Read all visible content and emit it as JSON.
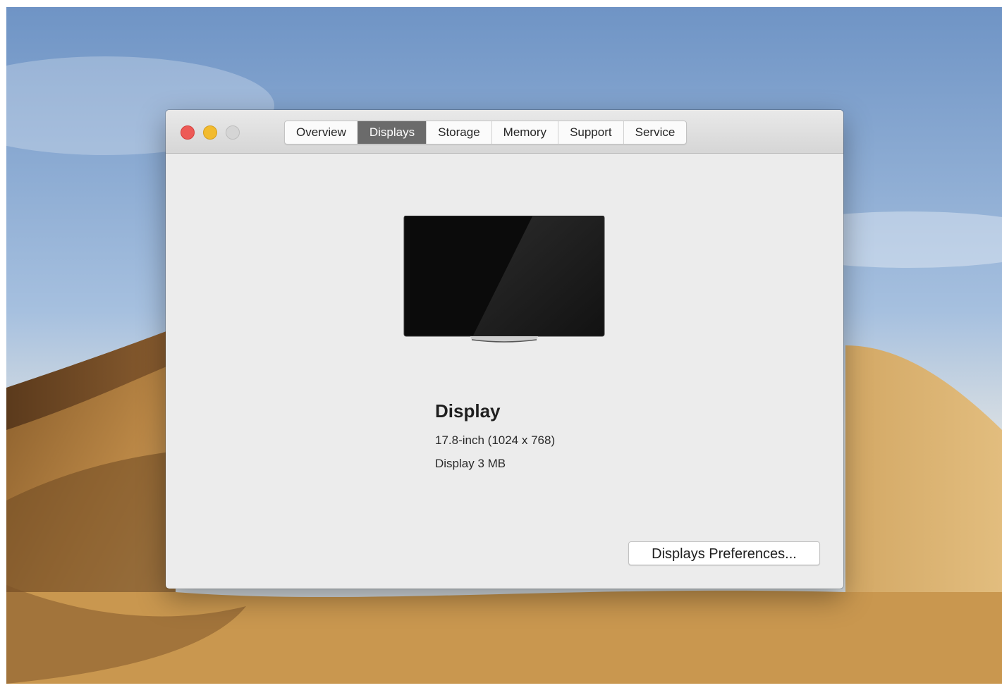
{
  "window": {
    "tabs": [
      {
        "label": "Overview"
      },
      {
        "label": "Displays"
      },
      {
        "label": "Storage"
      },
      {
        "label": "Memory"
      },
      {
        "label": "Support"
      },
      {
        "label": "Service"
      }
    ],
    "active_tab": "Displays"
  },
  "display": {
    "title": "Display",
    "size_resolution": "17.8-inch (1024 x 768)",
    "memory": "Display 3 MB",
    "preferences_button": "Displays Preferences..."
  },
  "icons": {
    "close": "close-button-red",
    "minimize": "minimize-button-yellow",
    "zoom": "zoom-button-disabled",
    "monitor": "display-monitor-icon"
  },
  "colors": {
    "close": "#ed5a56",
    "minimize": "#f2bb2f",
    "zoom_disabled": "#d5d5d5",
    "active_tab": "#6b6b6b",
    "window_bg": "#ececec"
  }
}
